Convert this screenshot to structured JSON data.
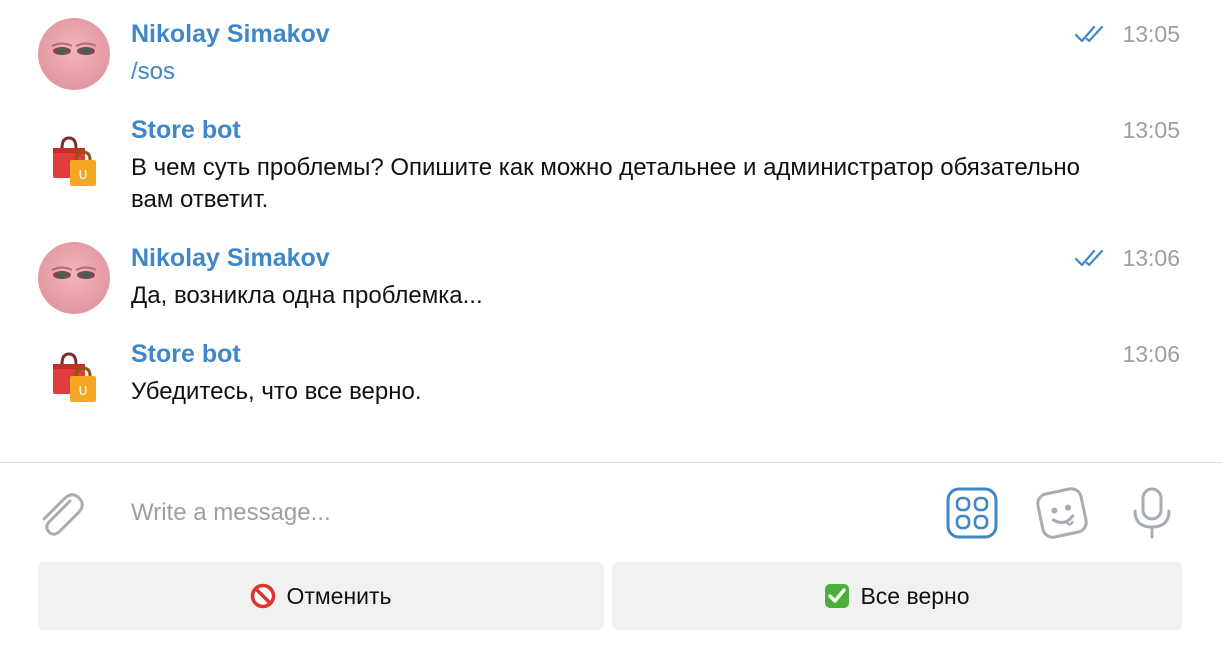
{
  "messages": [
    {
      "sender": "Nikolay Simakov",
      "text": "/sos",
      "time": "13:05",
      "read": true,
      "avatar": "user-avatar"
    },
    {
      "sender": "Store bot",
      "text": "В чем суть проблемы? Опишите как можно детальнее и администратор обязательно вам ответит.",
      "time": "13:05",
      "read": false,
      "avatar": "shopping-bags-icon"
    },
    {
      "sender": "Nikolay Simakov",
      "text": "Да, возникла одна проблемка...",
      "time": "13:06",
      "read": true,
      "avatar": "user-avatar"
    },
    {
      "sender": "Store bot",
      "text": "Убедитесь, что все верно.",
      "time": "13:06",
      "read": false,
      "avatar": "shopping-bags-icon"
    }
  ],
  "composer": {
    "placeholder": "Write a message...",
    "icons": [
      "paperclip-icon",
      "bot-keyboard-icon",
      "sticker-icon",
      "microphone-icon"
    ]
  },
  "keyboard": {
    "buttons": [
      {
        "label": "Отменить",
        "icon": "prohibited-icon"
      },
      {
        "label": "Все верно",
        "icon": "check-mark-button-icon"
      }
    ]
  },
  "colors": {
    "accent": "#3f87c6",
    "time": "#9aa0a6",
    "button_bg": "#f1f1f1"
  }
}
